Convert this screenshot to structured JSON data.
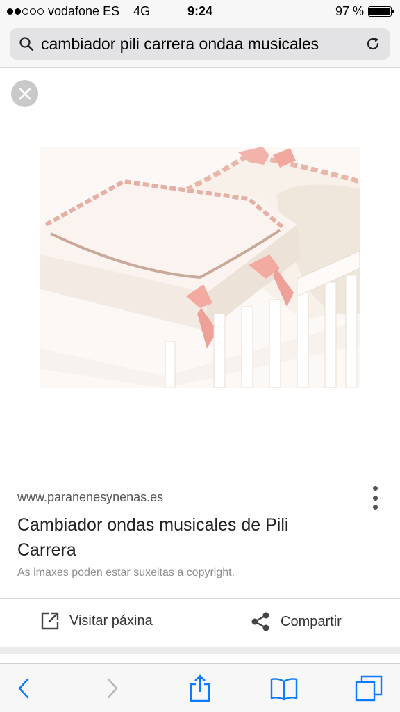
{
  "status_bar": {
    "carrier": "vodafone ES",
    "network": "4G",
    "time": "9:24",
    "battery": "97 %",
    "battery_level": 0.97
  },
  "search": {
    "query": "cambiador pili carrera ondaa musicales",
    "icon": "search-icon",
    "reload_icon": "reload-icon"
  },
  "viewer": {
    "close_icon": "close-icon"
  },
  "result": {
    "site": "www.paranenesynenas.es",
    "title": "Cambiador ondas musicales de Pili Carrera",
    "copyright": "As imaxes poden estar suxeitas a copyright.",
    "more_icon": "more-vert-icon"
  },
  "actions": {
    "visit_label": "Visitar páxina",
    "share_label": "Compartir",
    "visit_icon": "open-external-icon",
    "share_icon": "share-icon"
  },
  "toolbar": {
    "back_icon": "back-icon",
    "forward_icon": "forward-icon",
    "share_icon": "share-upload-icon",
    "bookmarks_icon": "bookmarks-icon",
    "tabs_icon": "tabs-icon"
  },
  "colors": {
    "ios_blue": "#0a7aff",
    "pink_ribbon": "#f2b3ab",
    "cream": "#f6ede6"
  }
}
